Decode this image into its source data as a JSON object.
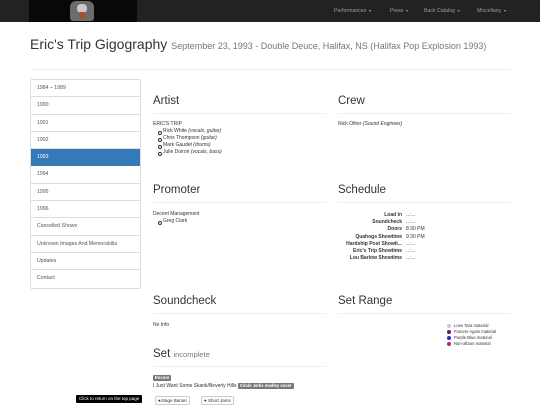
{
  "navbar": {
    "items": [
      {
        "label": "Performances"
      },
      {
        "label": "Press"
      },
      {
        "label": "Back Catalog"
      },
      {
        "label": "Miscellany"
      }
    ]
  },
  "header": {
    "title": "Eric's Trip Gigography",
    "subtitle": "September 23, 1993 - Double Deuce, Halifax, NS (Halifax Pop Explosion 1993)"
  },
  "sidebar": {
    "items": [
      {
        "label": "1984 – 1989"
      },
      {
        "label": "1990"
      },
      {
        "label": "1991"
      },
      {
        "label": "1992"
      },
      {
        "label": "1993",
        "active": true
      },
      {
        "label": "1994"
      },
      {
        "label": "1995"
      },
      {
        "label": "1996"
      },
      {
        "label": "Cancelled Shows"
      },
      {
        "label": "Unknown Images And Memorabilia"
      },
      {
        "label": "Updates"
      },
      {
        "label": "Contact"
      }
    ]
  },
  "artist": {
    "heading": "Artist",
    "name": "ERIC'S TRIP",
    "members": [
      {
        "name": "Rick White",
        "role": "(vocals, guitar)"
      },
      {
        "name": "Chris Thompson",
        "role": "(guitar)"
      },
      {
        "name": "Mark Gaudet",
        "role": "(drums)"
      },
      {
        "name": "Julie Doiron",
        "role": "(vocals, bass)"
      }
    ]
  },
  "crew": {
    "heading": "Crew",
    "name": "Nick Other",
    "role": "(Sound Engineer)"
  },
  "promoter": {
    "heading": "Promoter",
    "name": "Decent Management",
    "contacts": [
      "Greg Clark"
    ]
  },
  "schedule": {
    "heading": "Schedule",
    "rows": [
      {
        "label": "Load In",
        "value": "...:..."
      },
      {
        "label": "Soundcheck",
        "value": "...:..."
      },
      {
        "label": "Doors",
        "value": "8:30 PM"
      },
      {
        "label": "Quahogs Showtime",
        "value": "9:30 PM"
      },
      {
        "label": "Hardship Post Showti...",
        "value": "...:..."
      },
      {
        "label": "Eric's Trip Showtime",
        "value": "...:..."
      },
      {
        "label": "Lou Barlow Showtime",
        "value": "...:..."
      }
    ]
  },
  "soundcheck": {
    "heading": "Soundcheck",
    "text": "No Info"
  },
  "set_range": {
    "heading": "Set Range",
    "legend": [
      {
        "label": "Love Tara material",
        "color": "#c9c9c9"
      },
      {
        "label": "Forever Again material",
        "color": "#6a1b6e"
      },
      {
        "label": "Purple Blue material",
        "color": "#2c2cc7"
      },
      {
        "label": "Non-album material",
        "color": "#c01f6a"
      }
    ]
  },
  "set": {
    "heading": "Set",
    "status": "incomplete",
    "encore_label": "Encore",
    "song": "I Just Want Some Skank/Beverly Hills",
    "song_badge": "Circle Jerks medley cover",
    "buttons": {
      "stage_banter": "Stage Banter",
      "short_jams": "Short Jams"
    }
  },
  "tooltip": {
    "text": "Click to return on the top page"
  }
}
